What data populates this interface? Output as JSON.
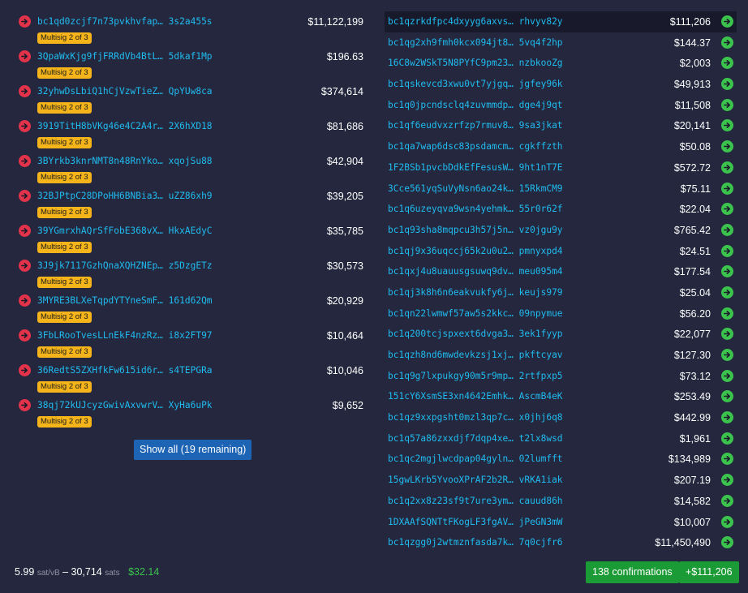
{
  "inputs": [
    {
      "address": "bc1qd0zcjf7n73pvkhvfap… 3s2a455s",
      "amount": "$11,122,199",
      "badge": "Multisig 2 of 3"
    },
    {
      "address": "3QpaWxKjg9fjFRRdVb4BtL… 5dkaf1Mp",
      "amount": "$196.63",
      "badge": "Multisig 2 of 3"
    },
    {
      "address": "32yhwDsLbiQ1hCjVzwTieZ… QpYUw8ca",
      "amount": "$374,614",
      "badge": "Multisig 2 of 3"
    },
    {
      "address": "3919TitH8bVKg46e4C2A4r… 2X6hXD18",
      "amount": "$81,686",
      "badge": "Multisig 2 of 3"
    },
    {
      "address": "3BYrkb3knrNMT8n48RnYko… xqojSu88",
      "amount": "$42,904",
      "badge": "Multisig 2 of 3"
    },
    {
      "address": "32BJPtpC28DPoHH6BNBia3… uZZ86xh9",
      "amount": "$39,205",
      "badge": "Multisig 2 of 3"
    },
    {
      "address": "39YGmrxhAQrSfFobE368vX… HkxAEdyC",
      "amount": "$35,785",
      "badge": "Multisig 2 of 3"
    },
    {
      "address": "3J9jk7117GzhQnaXQHZNEp… z5DzgETz",
      "amount": "$30,573",
      "badge": "Multisig 2 of 3"
    },
    {
      "address": "3MYRE3BLXeTqpdYTYneSmF… 161d62Qm",
      "amount": "$20,929",
      "badge": "Multisig 2 of 3"
    },
    {
      "address": "3FbLRooTvesLLnEkF4nzRz… i8x2FT97",
      "amount": "$10,464",
      "badge": "Multisig 2 of 3"
    },
    {
      "address": "36RedtS5ZXHfkFw615id6r… s4TEPGRa",
      "amount": "$10,046",
      "badge": "Multisig 2 of 3"
    },
    {
      "address": "38qj72kUJcyzGwivAxvwrV… XyHa6uPk",
      "amount": "$9,652",
      "badge": "Multisig 2 of 3"
    }
  ],
  "show_all_label": "Show all (19 remaining)",
  "outputs": [
    {
      "address": "bc1qzrkdfpc4dxyyg6axvs… rhvyv82y",
      "amount": "$111,206"
    },
    {
      "address": "bc1qg2xh9fmh0kcx094jt8… 5vq4f2hp",
      "amount": "$144.37"
    },
    {
      "address": "16C8w2WSkT5N8PYfC9pm23… nzbkooZg",
      "amount": "$2,003"
    },
    {
      "address": "bc1qskevcd3xwu0vt7yjgq… jgfey96k",
      "amount": "$49,913"
    },
    {
      "address": "bc1q0jpcndsclq4zuvmmdp… dge4j9qt",
      "amount": "$11,508"
    },
    {
      "address": "bc1qf6eudvxzrfzp7rmuv8… 9sa3jkat",
      "amount": "$20,141"
    },
    {
      "address": "bc1qa7wap6dsc83psdamcm… cgkffzth",
      "amount": "$50.08"
    },
    {
      "address": "1F2BSb1pvcbDdkEfFesusW… 9ht1nT7E",
      "amount": "$572.72"
    },
    {
      "address": "3Cce561yqSuVyNsn6ao24k… 15RkmCM9",
      "amount": "$75.11"
    },
    {
      "address": "bc1q6uzeyqva9wsn4yehmk… 55r0r62f",
      "amount": "$22.04"
    },
    {
      "address": "bc1q93sha8mqpcu3h57j5n… vz0jgu9y",
      "amount": "$765.42"
    },
    {
      "address": "bc1qj9x36uqccj65k2u0u2… pmnyxpd4",
      "amount": "$24.51"
    },
    {
      "address": "bc1qxj4u8uauusgsuwq9dv… meu095m4",
      "amount": "$177.54"
    },
    {
      "address": "bc1qj3k8h6n6eakvukfy6j… keujs979",
      "amount": "$25.04"
    },
    {
      "address": "bc1qn22lwmwf57aw5s2kkc… 09npymue",
      "amount": "$56.20"
    },
    {
      "address": "bc1q200tcjspxext6dvga3… 3ek1fyyp",
      "amount": "$22,077"
    },
    {
      "address": "bc1qzh8nd6mwdevkzsj1xj… pkftcyav",
      "amount": "$127.30"
    },
    {
      "address": "bc1q9g7lxpukgy90m5r9mp… 2rtfpxp5",
      "amount": "$73.12"
    },
    {
      "address": "151cY6XsmSE3xn4642Emhk… AscmB4eK",
      "amount": "$253.49"
    },
    {
      "address": "bc1qz9xxpgsht0mzl3qp7c… x0jhj6q8",
      "amount": "$442.99"
    },
    {
      "address": "bc1q57a86zxxdjf7dqp4xe… t2lx8wsd",
      "amount": "$1,961"
    },
    {
      "address": "bc1qc2mgjlwcdpap04gyln… 02lumfft",
      "amount": "$134,989"
    },
    {
      "address": "15gwLKrb5YvooXPrAF2b2R… vRKA1iak",
      "amount": "$207.19"
    },
    {
      "address": "bc1q2xx8z23sf9t7ure3ym… cauud86h",
      "amount": "$14,582"
    },
    {
      "address": "1DXAAfSQNTtFKogLF3fgAV… jPeGN3mW",
      "amount": "$10,007"
    },
    {
      "address": "bc1qzgg0j2wtmznfasda7k… 7q0cjfr6",
      "amount": "$11,450,490"
    }
  ],
  "footer": {
    "fee_rate": "5.99",
    "fee_rate_unit": "sat/vB",
    "dash": " – ",
    "fee_sats": "30,714",
    "fee_sats_unit": "sats",
    "fee_usd": "$32.14",
    "confirmations_label": "138 confirmations",
    "total_label": "+$111,206"
  },
  "colors": {
    "background": "#24273d",
    "address": "#20bcf0",
    "input_arrow": "#e2334b",
    "output_arrow": "#3bc34e",
    "badge": "#f5b419",
    "show_all_button": "#1d64b5",
    "green_button": "#1b9b35"
  },
  "icons": {
    "input": "arrow-right-red-circle-icon",
    "output": "arrow-right-green-circle-icon"
  }
}
